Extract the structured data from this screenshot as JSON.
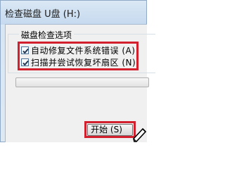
{
  "window": {
    "title": "检查磁盘 U盘 (H:)"
  },
  "group": {
    "label": "磁盘检查选项",
    "options": [
      {
        "label": "自动修复文件系统错误 (A)",
        "checked": true
      },
      {
        "label": "扫描并尝试恢复坏扇区 (N)",
        "checked": true
      }
    ]
  },
  "progress": {
    "value": 0
  },
  "buttons": {
    "start_label": "开始 (S)"
  },
  "colors": {
    "highlight": "#d2202f",
    "titlebar": "#cfe0f1",
    "client": "#f0f0f0"
  },
  "icons": {
    "cursor": "pen-cursor-icon"
  }
}
